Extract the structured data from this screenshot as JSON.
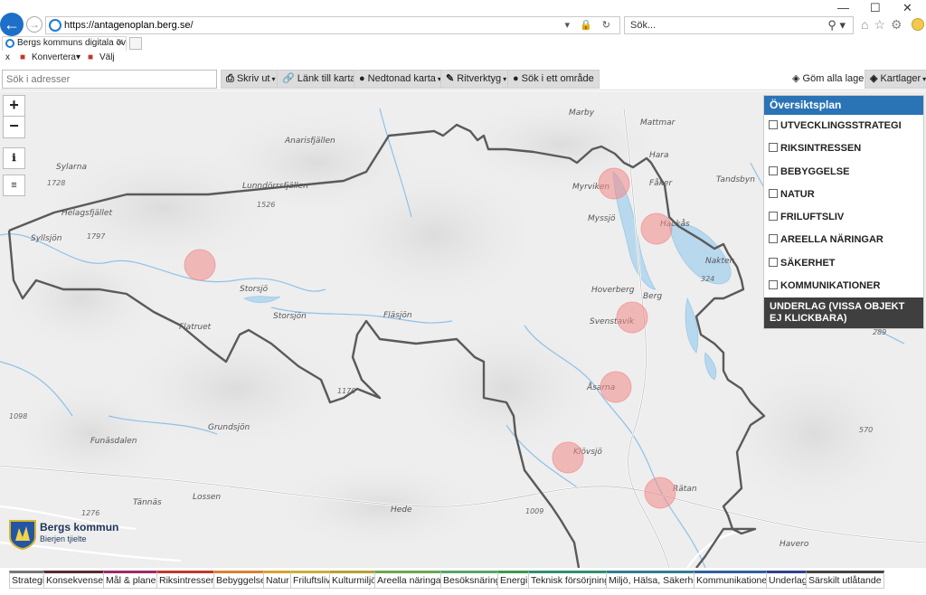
{
  "browser": {
    "url_prefix": "https://",
    "url_domain": "antagenoplan.berg.se",
    "url_path": "/",
    "search_placeholder": "Sök...",
    "tab_title": "Bergs kommuns digitala öv...",
    "tools": {
      "konvertera": "Konvertera",
      "valj": "Välj",
      "close": "x"
    }
  },
  "toolbar": {
    "address_placeholder": "Sök i adresser",
    "buttons": [
      "Skriv ut",
      "Länk till karta",
      "Nedtonad karta",
      "Ritverktyg",
      "Sök i ett område"
    ],
    "hide_layers": "Göm alla lager",
    "layers": "Kartlager"
  },
  "panel": {
    "title": "Översiktsplan",
    "items": [
      "UTVECKLINGSSTRATEGI",
      "RIKSINTRESSEN",
      "BEBYGGELSE",
      "NATUR",
      "FRILUFTSLIV",
      "AREELLA NÄRINGAR",
      "SÄKERHET",
      "KOMMUNIKATIONER"
    ],
    "underlag": "UNDERLAG (VISSA OBJEKT EJ KLICKBARA)"
  },
  "map": {
    "places": [
      "Sylarna",
      "Helagsfjället",
      "Anarisfjällen",
      "Lunndörrsfjällen",
      "Myrviken",
      "Myssjö",
      "Hackås",
      "Fåker",
      "Tandsbyn",
      "Hara",
      "Storsjön",
      "Storsjö",
      "Flatruet",
      "Fläsjön",
      "Hoverberg",
      "Berg",
      "Svenstavik",
      "Åsarna",
      "Klövsjö",
      "Rätan",
      "Funäsdalen",
      "Tännäs",
      "Hede",
      "Grundsjön",
      "Lossen",
      "Nakten",
      "Havero",
      "Marby",
      "Mattmar",
      "Syllsjön"
    ],
    "heights": [
      "1728",
      "1526",
      "1797",
      "1170",
      "1098",
      "1276",
      "1009",
      "324",
      "289",
      "570"
    ],
    "hotspot_count": 8
  },
  "logo": {
    "name": "Bergs kommun",
    "subtitle": "Bierjen tjielte"
  },
  "bottom_tabs": [
    {
      "label": "Strategi",
      "color": "#777777"
    },
    {
      "label": "Konsekvenser",
      "color": "#5b2a2a"
    },
    {
      "label": "Mål & planer",
      "color": "#9c2a6b"
    },
    {
      "label": "Riksintressen",
      "color": "#c0392b"
    },
    {
      "label": "Bebyggelse",
      "color": "#d9812f"
    },
    {
      "label": "Natur",
      "color": "#d9a02f"
    },
    {
      "label": "Friluftsliv",
      "color": "#c9b037"
    },
    {
      "label": "Kulturmiljö",
      "color": "#b7a12f"
    },
    {
      "label": "Areella näringar",
      "color": "#6aa84f"
    },
    {
      "label": "Besöksnäring",
      "color": "#5aa36a"
    },
    {
      "label": "Energi",
      "color": "#3c9a4a"
    },
    {
      "label": "Teknisk försörjning",
      "color": "#2f8f6f"
    },
    {
      "label": "Miljö, Hälsa, Säkerhet",
      "color": "#2f7f8f"
    },
    {
      "label": "Kommunikationer",
      "color": "#2f5f9f"
    },
    {
      "label": "Underlag",
      "color": "#2f3f8f"
    },
    {
      "label": "Särskilt utlåtande",
      "color": "#444444"
    }
  ]
}
